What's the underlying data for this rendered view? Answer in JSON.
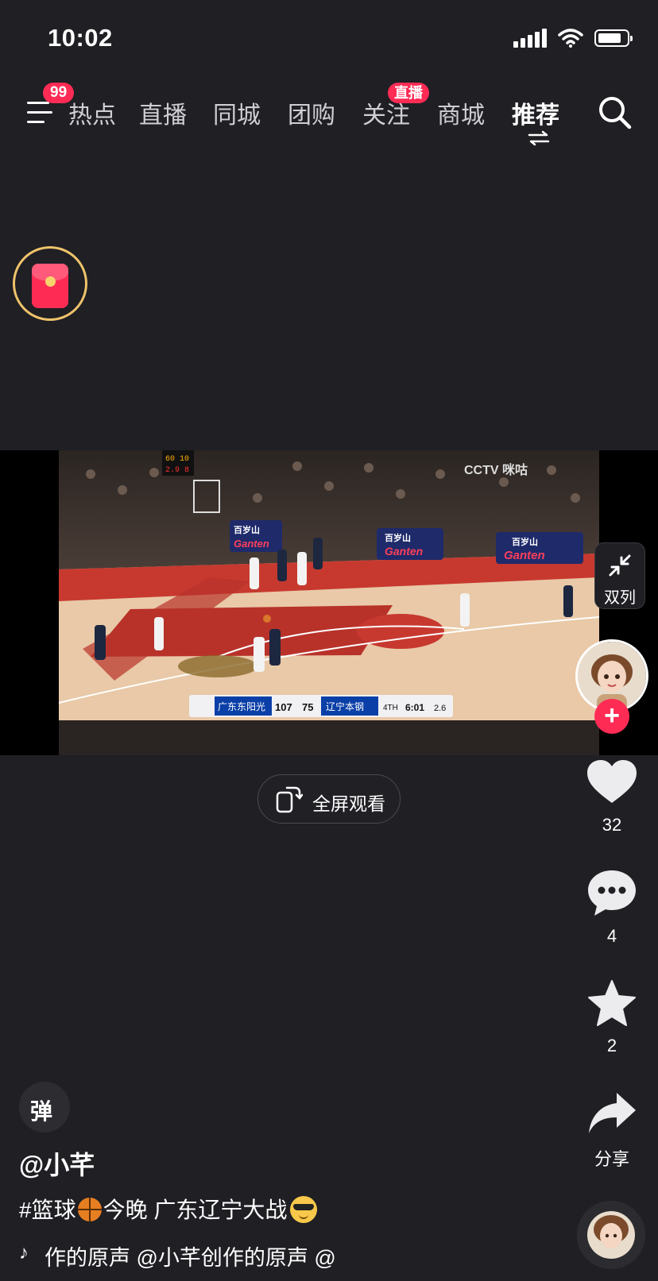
{
  "status_bar": {
    "time": "10:02"
  },
  "top_nav": {
    "menu_badge": "99",
    "tabs": [
      {
        "label": "热点"
      },
      {
        "label": "直播"
      },
      {
        "label": "同城"
      },
      {
        "label": "团购"
      },
      {
        "label": "关注"
      },
      {
        "label": "商城"
      },
      {
        "label": "推荐",
        "active": true
      }
    ],
    "follow_badge": "直播"
  },
  "video": {
    "dual_view_label": "双列",
    "fullscreen_label": "全屏观看",
    "scoreboard": {
      "home_team": "广东东阳光",
      "home_score": "107",
      "away_score": "75",
      "away_team": "辽宁本钢",
      "quarter": "4TH",
      "clock": "6:01",
      "shot_clock": "2.6"
    },
    "arena_board": {
      "top": "60 10",
      "bottom": "2.9 8"
    },
    "banner_brand": "百岁山",
    "banner_text": "Ganten",
    "broadcaster": "CCTV 咪咕"
  },
  "actions": {
    "likes": "32",
    "comments": "4",
    "favorites": "2",
    "share_label": "分享"
  },
  "post": {
    "danmu_label": "弹",
    "author": "@小芊",
    "caption_tag": "#篮球",
    "caption_text": "今晚  广东辽宁大战",
    "music_text": "作的原声    @小芊创作的原声    @"
  },
  "colors": {
    "accent": "#fe2c55",
    "background": "#1f1f24"
  }
}
